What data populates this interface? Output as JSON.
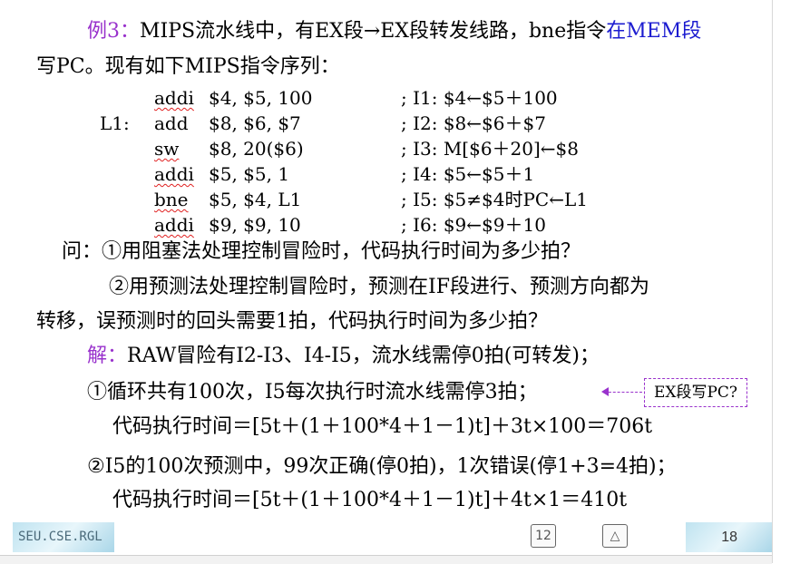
{
  "title": {
    "label": "例3：",
    "text": "MIPS流水线中，有EX段→EX段转发线路，bne指令",
    "highlight": "在MEM段",
    "line2": "写PC。现有如下MIPS指令序列："
  },
  "code": [
    {
      "label": "",
      "op": "addi",
      "args": "$4, $5, 100",
      "comment": "; I1: $4←$5＋100"
    },
    {
      "label": "L1:",
      "op": "add",
      "args": "$8, $6, $7",
      "comment": "; I2: $8←$6＋$7"
    },
    {
      "label": "",
      "op": "sw",
      "args": "$8, 20($6)",
      "comment": "; I3: M[$6＋20]←$8"
    },
    {
      "label": "",
      "op": "addi",
      "args": "$5, $5, 1",
      "comment": "; I4: $5←$5＋1"
    },
    {
      "label": "",
      "op": "bne",
      "args": "$5, $4, L1",
      "comment": "; I5: $5≠$4时PC←L1"
    },
    {
      "label": "",
      "op": "addi",
      "args": "$9, $9, 10",
      "comment": "; I6: $9←$9＋10"
    }
  ],
  "question": {
    "q1": "问：①用阻塞法处理控制冒险时，代码执行时间为多少拍？",
    "q2a": "②用预测法处理控制冒险时，预测在IF段进行、预测方向都为",
    "q2b": "转移，误预测时的回头需要1拍，代码执行时间为多少拍？"
  },
  "answer": {
    "label": "解：",
    "intro": "RAW冒险有I2-I3、I4-I5，流水线需停0拍(可转发)；",
    "a1": "①循环共有100次，I5每次执行时流水线需停3拍；",
    "a1_time": "代码执行时间＝[5t＋(1＋100*4＋1－1)t]＋3t×100＝706t",
    "a2": "②I5的100次预测中，99次正确(停0拍)，1次错误(停1+3=4拍)；",
    "a2_time": "代码执行时间＝[5t＋(1＋100*4＋1－1)t]＋4t×1＝410t",
    "callout": "EX段写PC?"
  },
  "footer": {
    "left": "SEU.CSE.RGL",
    "page": "18",
    "nav_prev": "12",
    "nav_next": "△"
  },
  "colors": {
    "accent": "#9932cc",
    "highlight": "#1c1cd0",
    "wavy": "#e02020"
  }
}
